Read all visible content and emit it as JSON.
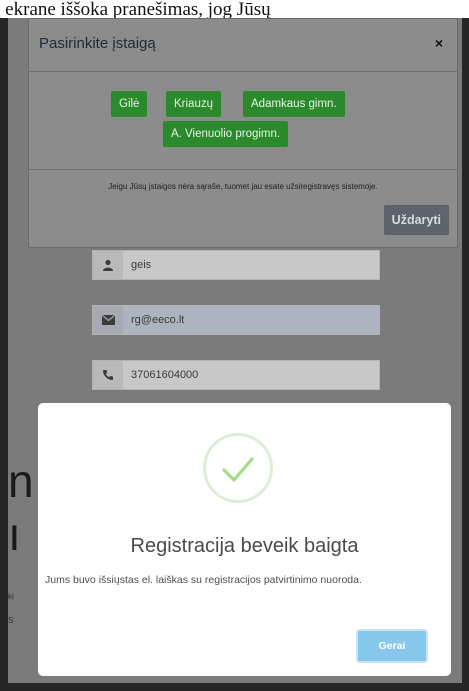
{
  "top_caption": "ą ekrane iššoka pranešimas, jog Jūsų",
  "institution_modal": {
    "title": "Pasirinkite įstaigą",
    "close_glyph": "×",
    "institutions": [
      "Gilė",
      "Kriauzų",
      "Adamkaus gimn.",
      "A. Vienuolio progimn."
    ],
    "note": "Jeigu Jūsų įstaigos nėra sąraše, tuomet jau esate užsiregistravęs sistemoje.",
    "close_button": "Uždaryti"
  },
  "form": {
    "fields": [
      {
        "icon": "user-icon",
        "value": "geis"
      },
      {
        "icon": "envelope-icon",
        "value": "rg@eeco.lt"
      },
      {
        "icon": "phone-icon",
        "value": "37061604000"
      }
    ]
  },
  "success_dialog": {
    "title": "Registracija beveik baigta",
    "text": "Jums buvo išsiųstas el. laiškas su registracijos patvirtinimo nuoroda.",
    "ok_button": "Gerai"
  },
  "colors": {
    "success_green": "#a5dc86",
    "ok_blue": "#88c7ec",
    "institution_green": "#2b8a2b"
  }
}
